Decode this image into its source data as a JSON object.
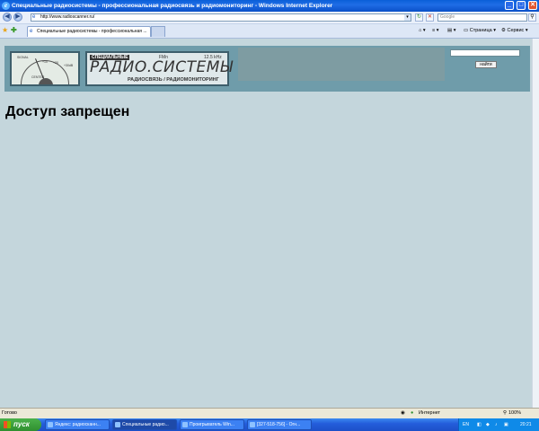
{
  "window": {
    "title": "Специальные радиосистемы - профессиональная радиосвязь и радиомониторинг - Windows Internet Explorer",
    "minimize": "_",
    "maximize": "□",
    "close": "✕"
  },
  "address": {
    "url": "http://www.radioscanner.ru/",
    "refresh": "↻",
    "stop": "✕",
    "search_placeholder": "Google"
  },
  "tabs": [
    {
      "label": "Специальные радиосистемы - профессиональная ..."
    }
  ],
  "commands": {
    "page": "Страница",
    "tools": "Сервис"
  },
  "banner": {
    "logo_tag": "СПЕЦИАЛЬНЫЕ",
    "logo_mark": "РАДИО.СИСТЕМЫ",
    "logo_fm": "FMn",
    "logo_khz": "12.5 kHz",
    "logo_tagline": "РАДИОСВЯЗЬ / РАДИОМОНИТОРИНГ",
    "meter_labels": [
      "SIGNAL",
      "CENTER",
      "+10",
      "+20",
      "+30dB"
    ],
    "search_button": "найти"
  },
  "main": {
    "heading": "Доступ запрещен"
  },
  "status": {
    "text": "Готово",
    "zone": "Интернет",
    "zoom": "100%"
  },
  "taskbar": {
    "start": "пуск",
    "tasks": [
      {
        "label": "Яндекс: радиосканн..."
      },
      {
        "label": "Специальные радио..."
      },
      {
        "label": "Проигрыватель Win..."
      },
      {
        "label": "[327-518-756] - Огн..."
      }
    ],
    "lang": "EN",
    "clock": "20:21"
  }
}
